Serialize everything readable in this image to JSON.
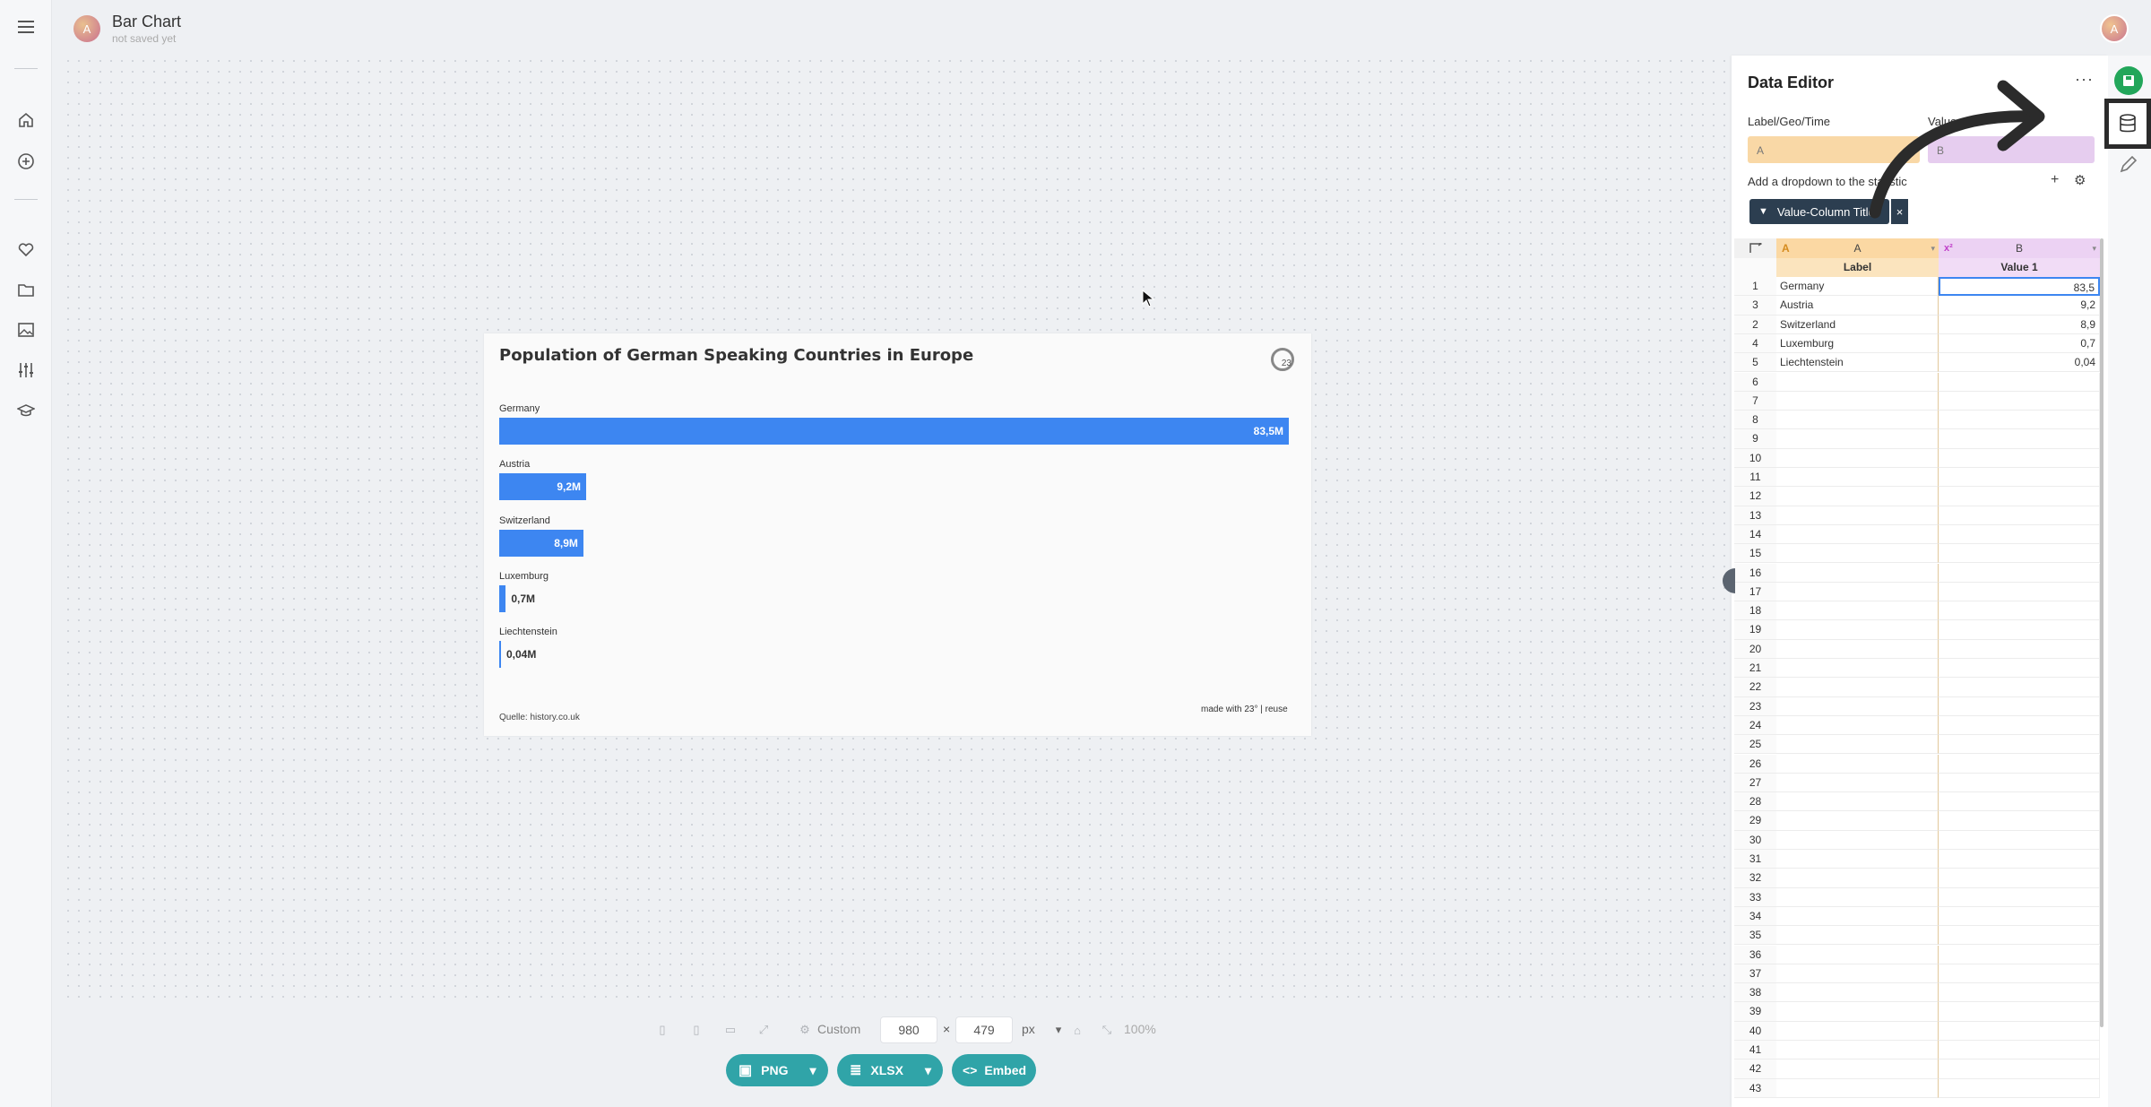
{
  "header": {
    "avatar_letter": "A",
    "title": "Bar Chart",
    "subtitle": "not saved yet",
    "user_avatar_letter": "A"
  },
  "sidebar": {
    "items": [
      "menu-icon",
      "home-icon",
      "add-circle-icon",
      "heart-icon",
      "folder-icon",
      "image-icon",
      "sliders-icon",
      "graduation-cap-icon"
    ]
  },
  "chart": {
    "title": "Population of German Speaking Countries in Europe",
    "logo_text": "23",
    "source": "Quelle: history.co.uk",
    "credit": "made with 23° | reuse",
    "bar_color": "#3d86f1"
  },
  "chart_data": {
    "type": "bar",
    "orientation": "horizontal",
    "title": "Population of German Speaking Countries in Europe",
    "categories": [
      "Germany",
      "Austria",
      "Switzerland",
      "Luxemburg",
      "Liechtenstein"
    ],
    "values": [
      83.5,
      9.2,
      8.9,
      0.7,
      0.04
    ],
    "value_labels": [
      "83,5M",
      "9,2M",
      "8,9M",
      "0,7M",
      "0,04M"
    ],
    "xlim": [
      0,
      83.5
    ]
  },
  "toolbar": {
    "preset_label": "Custom",
    "width": "980",
    "times": "×",
    "height": "479",
    "unit": "px",
    "zoom": "100%",
    "export_png": "PNG",
    "export_xlsx": "XLSX",
    "embed": "Embed"
  },
  "editor": {
    "title": "Data Editor",
    "more": "···",
    "label_col_heading": "Label/Geo/Time",
    "values_col_heading": "Values",
    "label_chip": "A",
    "values_chip": "B",
    "dropdown_text": "Add a dropdown to the statistic",
    "plus": "+",
    "filter_label": "Value-Column Titles",
    "filter_close": "×",
    "grid": {
      "col_a_letter": "A",
      "col_b_letter": "B",
      "col_a_header": "Label",
      "col_b_header": "Value 1",
      "rows": [
        {
          "num": "1",
          "a": "Germany",
          "b": "83,5"
        },
        {
          "num": "3",
          "a": "Austria",
          "b": "9,2"
        },
        {
          "num": "2",
          "a": "Switzerland",
          "b": "8,9"
        },
        {
          "num": "4",
          "a": "Luxemburg",
          "b": "0,7"
        },
        {
          "num": "5",
          "a": "Liechtenstein",
          "b": "0,04"
        },
        {
          "num": "6",
          "a": "",
          "b": ""
        },
        {
          "num": "7",
          "a": "",
          "b": ""
        },
        {
          "num": "8",
          "a": "",
          "b": ""
        },
        {
          "num": "9",
          "a": "",
          "b": ""
        },
        {
          "num": "10",
          "a": "",
          "b": ""
        },
        {
          "num": "11",
          "a": "",
          "b": ""
        },
        {
          "num": "12",
          "a": "",
          "b": ""
        },
        {
          "num": "13",
          "a": "",
          "b": ""
        },
        {
          "num": "14",
          "a": "",
          "b": ""
        },
        {
          "num": "15",
          "a": "",
          "b": ""
        },
        {
          "num": "16",
          "a": "",
          "b": ""
        },
        {
          "num": "17",
          "a": "",
          "b": ""
        },
        {
          "num": "18",
          "a": "",
          "b": ""
        },
        {
          "num": "19",
          "a": "",
          "b": ""
        },
        {
          "num": "20",
          "a": "",
          "b": ""
        },
        {
          "num": "21",
          "a": "",
          "b": ""
        },
        {
          "num": "22",
          "a": "",
          "b": ""
        },
        {
          "num": "23",
          "a": "",
          "b": ""
        },
        {
          "num": "24",
          "a": "",
          "b": ""
        },
        {
          "num": "25",
          "a": "",
          "b": ""
        },
        {
          "num": "26",
          "a": "",
          "b": ""
        },
        {
          "num": "27",
          "a": "",
          "b": ""
        },
        {
          "num": "28",
          "a": "",
          "b": ""
        },
        {
          "num": "29",
          "a": "",
          "b": ""
        },
        {
          "num": "30",
          "a": "",
          "b": ""
        },
        {
          "num": "31",
          "a": "",
          "b": ""
        },
        {
          "num": "32",
          "a": "",
          "b": ""
        },
        {
          "num": "33",
          "a": "",
          "b": ""
        },
        {
          "num": "34",
          "a": "",
          "b": ""
        },
        {
          "num": "35",
          "a": "",
          "b": ""
        },
        {
          "num": "36",
          "a": "",
          "b": ""
        },
        {
          "num": "37",
          "a": "",
          "b": ""
        },
        {
          "num": "38",
          "a": "",
          "b": ""
        },
        {
          "num": "39",
          "a": "",
          "b": ""
        },
        {
          "num": "40",
          "a": "",
          "b": ""
        },
        {
          "num": "41",
          "a": "",
          "b": ""
        },
        {
          "num": "42",
          "a": "",
          "b": ""
        },
        {
          "num": "43",
          "a": "",
          "b": ""
        }
      ]
    }
  },
  "right_rail": {
    "items": [
      "save-icon",
      "database-icon",
      "pencil-icon"
    ],
    "save_color": "#22a65a"
  }
}
